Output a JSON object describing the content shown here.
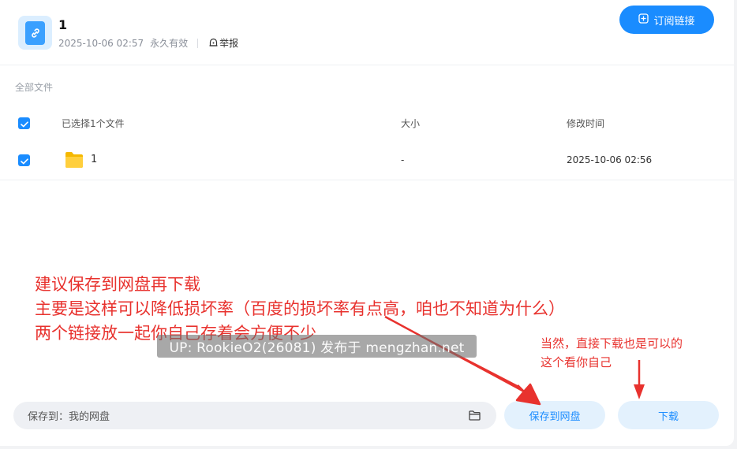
{
  "share": {
    "title": "1",
    "date": "2025-10-06 02:57",
    "validity": "永久有效",
    "report_label": "举报",
    "subscribe_label": "订阅链接"
  },
  "files": {
    "breadcrumb": "全部文件",
    "columns": {
      "selected": "已选择1个文件",
      "size": "大小",
      "modified": "修改时间"
    },
    "rows": [
      {
        "name": "1",
        "size": "-",
        "modified": "2025-10-06 02:56",
        "checked": true
      }
    ]
  },
  "annotations": {
    "main": [
      "建议保存到网盘再下载",
      "主要是这样可以降低损坏率（百度的损坏率有点高，咱也不知道为什么）",
      "两个链接放一起你自己存着会方便不少"
    ],
    "side": [
      "当然，直接下载也是可以的",
      "这个看你自己"
    ]
  },
  "watermark": "UP: RookieO2(26081) 发布于 mengzhan.net",
  "footer": {
    "save_path_label": "保存到：",
    "save_path_value": "我的网盘",
    "save_button": "保存到网盘",
    "download_button": "下载"
  },
  "colors": {
    "accent": "#1a8cff",
    "annotation": "#e8322e"
  },
  "icons": [
    "link-icon",
    "report-icon",
    "subscribe-plus-icon",
    "checkbox-checked-icon",
    "folder-icon",
    "folder-outline-icon"
  ]
}
